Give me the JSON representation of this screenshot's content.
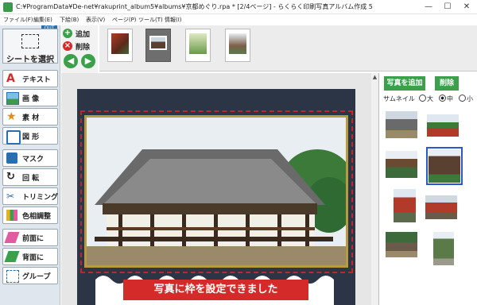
{
  "window": {
    "title": "C:¥ProgramData¥De-net¥rakuprint_album5¥albums¥京都めぐり.rpa * [2/4ページ] - らくらく印刷写真アルバム作成 5",
    "minimize": "—",
    "maximize": "☐",
    "close": "✕"
  },
  "menu": [
    "ファイル(F)",
    "編集(E)",
    "下絵(B)",
    "表示(V)",
    "ページ(P)",
    "ツール(T)",
    "情報(I)"
  ],
  "left_tools": {
    "out_badge": "OUT",
    "select": "シートを選択",
    "text": "テキスト",
    "image": "画 像",
    "material": "素 材",
    "shape": "図 形",
    "mask": "マスク",
    "rotate": "回 転",
    "trim": "トリミング",
    "color": "色相調整",
    "front": "前面に",
    "back": "背面に",
    "group": "グループ"
  },
  "page_buttons": {
    "add": "追加",
    "delete": "削除",
    "prev": "◀",
    "next": "▶"
  },
  "right_panel": {
    "add_photo": "写真を追加",
    "delete_photo": "削除",
    "thumbnail_label": "サムネイル",
    "size_large": "大",
    "size_medium": "中",
    "size_small": "小",
    "selected_size": "中"
  },
  "banner": "写真に枠を設定できました",
  "colors": {
    "accent_green": "#3aa14a",
    "banner_red": "#d42a2a",
    "frame_red": "#c0262c",
    "frame_gold": "#b89b3d"
  }
}
